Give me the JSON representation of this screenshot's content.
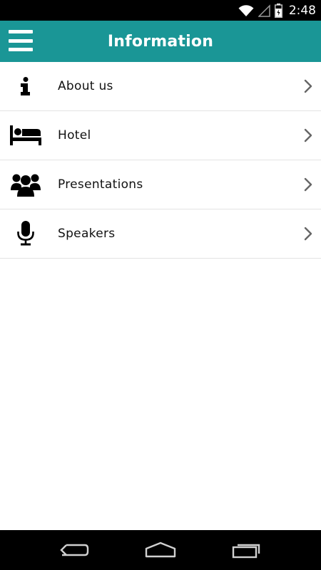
{
  "status_bar": {
    "time": "2:48",
    "icons": [
      "wifi-icon",
      "cell-signal-icon",
      "battery-icon"
    ]
  },
  "app_bar": {
    "title": "Information",
    "menu_icon": "hamburger-menu-icon",
    "color": "#1a9696"
  },
  "list": {
    "items": [
      {
        "label": "About us",
        "icon": "info-icon"
      },
      {
        "label": "Hotel",
        "icon": "bed-icon"
      },
      {
        "label": "Presentations",
        "icon": "group-icon"
      },
      {
        "label": "Speakers",
        "icon": "microphone-icon"
      }
    ],
    "chevron_icon": "chevron-right-icon"
  },
  "nav_bar": {
    "buttons": [
      "back-icon",
      "home-icon",
      "recent-apps-icon"
    ]
  }
}
